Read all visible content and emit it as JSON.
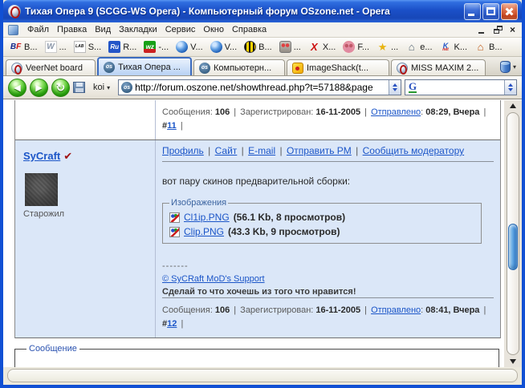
{
  "ui": {
    "sep": "|",
    "dropdown_arrow": "▾"
  },
  "icons": {
    "back": "◀",
    "forward": "▶",
    "reload": "↻",
    "close": "×"
  },
  "window": {
    "title": "Тихая Опера 9 (SCGG-WS Opera) - Компьютерный форум OSzone.net - Opera"
  },
  "menubar": {
    "items": [
      "Файл",
      "Правка",
      "Вид",
      "Закладки",
      "Сервис",
      "Окно",
      "Справка"
    ]
  },
  "bookmarks": {
    "items": [
      {
        "glyph": "B",
        "sub": "F",
        "label": "B..."
      },
      {
        "glyph": "W",
        "label": "..."
      },
      {
        "glyph": "LAB",
        "label": "S..."
      },
      {
        "glyph": "Ru",
        "label": "R..."
      },
      {
        "glyph": "wz",
        "label": "-..."
      },
      {
        "glyph": "",
        "label": "V..."
      },
      {
        "glyph": "",
        "label": "V..."
      },
      {
        "glyph": "",
        "label": "B..."
      },
      {
        "glyph": "",
        "label": "..."
      },
      {
        "glyph": "X",
        "label": "X..."
      },
      {
        "glyph": "",
        "label": "F..."
      },
      {
        "glyph": "★",
        "label": "..."
      },
      {
        "glyph": "⌂",
        "label": "e..."
      },
      {
        "glyph": "K",
        "sub": "net",
        "label": "K..."
      },
      {
        "glyph": "⌂",
        "label": "B..."
      }
    ]
  },
  "tabs": {
    "items": [
      {
        "icon": "opera",
        "label": "VeerNet board",
        "active": false
      },
      {
        "icon": "os",
        "icon_text": "os",
        "label": "Тихая Опера ...",
        "active": true
      },
      {
        "icon": "os",
        "icon_text": "os",
        "label": "Компьютерн...",
        "active": false
      },
      {
        "icon": "imageshack",
        "label": "ImageShack(t...",
        "active": false
      },
      {
        "icon": "opera",
        "label": "MISS MAXIM 2...",
        "active": false
      }
    ]
  },
  "addressbar": {
    "encoding": "koi",
    "favicon_text": "os",
    "url": "http://forum.oszone.net/showthread.php?t=57188&page",
    "search_icon_text": "G",
    "search_value": ""
  },
  "page": {
    "prev_post_footer": {
      "messages_label": "Сообщения:",
      "messages": "106",
      "registered_label": "Зарегистрирован:",
      "registered": "16-11-2005",
      "sent_link": "Отправлено",
      "colon": ":",
      "time": "08:29, Вчера",
      "hash": "#",
      "post_num": "11"
    },
    "post": {
      "author": "SyCraft",
      "verified_mark": "✔",
      "user_title": "Старожил",
      "links": [
        "Профиль",
        "Сайт",
        "E-mail",
        "Отправить PM",
        "Сообщить модератору"
      ],
      "body": "вот пару скинов предварительной сборки:",
      "attachments": {
        "legend": "Изображения",
        "items": [
          {
            "name": "Cl1ip.PNG",
            "meta": "(56.1 Kb, 8 просмотров)"
          },
          {
            "name": "Clip.PNG",
            "meta": "(43.3 Kb, 9 просмотров)"
          }
        ]
      },
      "signature": {
        "dashes": "-------",
        "link": "© SyCRaft MoD's Support",
        "text": "Сделай то что хочешь из того что нравится!"
      },
      "footer": {
        "messages_label": "Сообщения:",
        "messages": "106",
        "registered_label": "Зарегистрирован:",
        "registered": "16-11-2005",
        "sent_link": "Отправлено",
        "colon": ":",
        "time": "08:41, Вчера",
        "hash": "#",
        "post_num": "12"
      }
    },
    "reply_form": {
      "legend": "Сообщение"
    }
  },
  "colors": {
    "xp_title_blue": "#1b50c8",
    "xp_border_blue": "#1150d4",
    "link_blue": "#1c56c8",
    "post_bg": "#dbe7f8",
    "active_tab_bg": "#b8d2f4",
    "nav_green": "#3ab818",
    "close_red": "#cc4a22"
  }
}
